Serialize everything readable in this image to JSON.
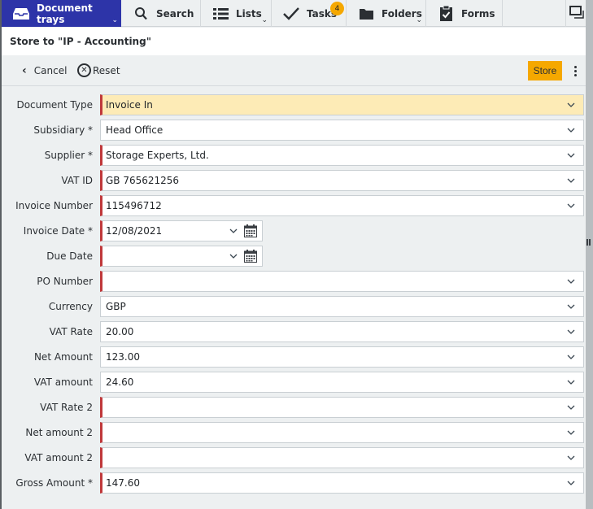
{
  "nav": {
    "items": [
      {
        "label": "Document trays",
        "icon": "inbox-tray-icon",
        "active": true,
        "has_dropdown": true
      },
      {
        "label": "Search",
        "icon": "search-icon",
        "active": false,
        "has_dropdown": false
      },
      {
        "label": "Lists",
        "icon": "list-icon",
        "active": false,
        "has_dropdown": true
      },
      {
        "label": "Tasks",
        "icon": "checkmark-icon",
        "active": false,
        "has_dropdown": false,
        "badge": "4"
      },
      {
        "label": "Folders",
        "icon": "folder-icon",
        "active": false,
        "has_dropdown": true
      },
      {
        "label": "Forms",
        "icon": "clipboard-check-icon",
        "active": false,
        "has_dropdown": false
      }
    ],
    "window_icon": "window-restore-icon",
    "active_color": "#2d34a8",
    "badge_color": "#f5a800"
  },
  "header": {
    "title": "Store to \"IP - Accounting\""
  },
  "toolbar": {
    "cancel_label": "Cancel",
    "reset_label": "Reset",
    "store_label": "Store",
    "store_color": "#f5a800"
  },
  "form": {
    "fields": [
      {
        "label": "Document Type",
        "value": "Invoice In",
        "required_marker": true,
        "highlight": true,
        "type": "select"
      },
      {
        "label": "Subsidiary *",
        "value": "Head Office",
        "required_marker": false,
        "type": "select"
      },
      {
        "label": "Supplier *",
        "value": "Storage Experts, Ltd.",
        "required_marker": true,
        "type": "select"
      },
      {
        "label": "VAT ID",
        "value": "GB 765621256",
        "required_marker": true,
        "type": "select"
      },
      {
        "label": "Invoice Number",
        "value": "115496712",
        "required_marker": true,
        "type": "select"
      },
      {
        "label": "Invoice Date *",
        "value": "12/08/2021",
        "required_marker": true,
        "type": "date"
      },
      {
        "label": "Due Date",
        "value": "",
        "required_marker": true,
        "type": "date"
      },
      {
        "label": "PO Number",
        "value": "",
        "required_marker": true,
        "type": "select"
      },
      {
        "label": "Currency",
        "value": "GBP",
        "required_marker": false,
        "type": "select"
      },
      {
        "label": "VAT Rate",
        "value": "20.00",
        "required_marker": false,
        "type": "select"
      },
      {
        "label": "Net Amount",
        "value": "123.00",
        "required_marker": false,
        "type": "select"
      },
      {
        "label": "VAT amount",
        "value": "24.60",
        "required_marker": false,
        "type": "select"
      },
      {
        "label": "VAT Rate 2",
        "value": "",
        "required_marker": true,
        "type": "select"
      },
      {
        "label": "Net amount 2",
        "value": "",
        "required_marker": true,
        "type": "select"
      },
      {
        "label": "VAT amount 2",
        "value": "",
        "required_marker": true,
        "type": "select"
      },
      {
        "label": "Gross Amount *",
        "value": "147.60",
        "required_marker": true,
        "type": "select"
      }
    ],
    "required_color": "#c0393b",
    "highlight_color": "#fdebb6"
  }
}
